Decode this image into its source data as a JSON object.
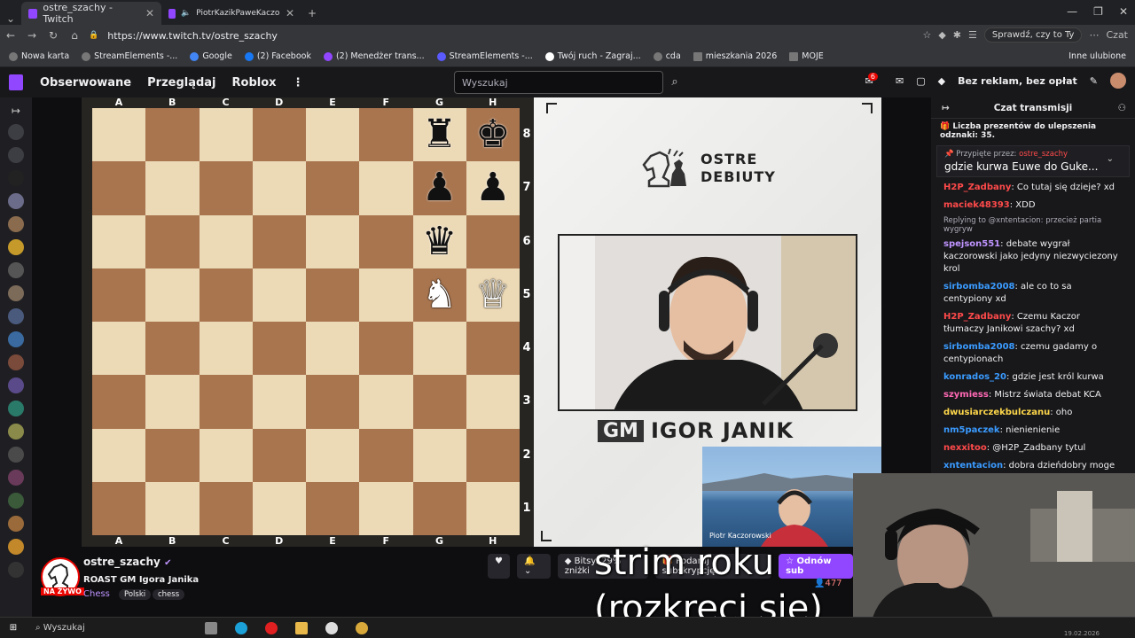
{
  "browser": {
    "tabs": [
      {
        "label": "ostre_szachy - Twitch",
        "active": true
      },
      {
        "label": "PiotrKazikPaweKaczorowski -",
        "active": false
      }
    ],
    "url": "https://www.twitch.tv/ostre_szachy",
    "ai_prompt": "Sprawdź, czy to Ty",
    "copilot": "Czat",
    "bookmarks": [
      "Nowa karta",
      "StreamElements -...",
      "Google",
      "(2) Facebook",
      "(2) Menedżer trans...",
      "StreamElements -...",
      "Twój ruch - Zagraj...",
      "cda",
      "mieszkania 2026",
      "MOJE"
    ],
    "bookmarks_other": "Inne ulubione"
  },
  "twitch_nav": {
    "following": "Obserwowane",
    "browse": "Przeglądaj",
    "roblox": "Roblox",
    "search_placeholder": "Wyszukaj",
    "notif_count": "6",
    "ad_free": "Bez reklam, bez opłat"
  },
  "chessboard": {
    "files": [
      "A",
      "B",
      "C",
      "D",
      "E",
      "F",
      "G",
      "H"
    ],
    "ranks": [
      "8",
      "7",
      "6",
      "5",
      "4",
      "3",
      "2",
      "1"
    ],
    "pieces": [
      {
        "square": "g8",
        "piece": "♜",
        "color": "black"
      },
      {
        "square": "h8",
        "piece": "♚",
        "color": "black"
      },
      {
        "square": "g7",
        "piece": "♟",
        "color": "black"
      },
      {
        "square": "h7",
        "piece": "♟",
        "color": "black"
      },
      {
        "square": "g6",
        "piece": "♛",
        "color": "black"
      },
      {
        "square": "g5",
        "piece": "♞",
        "color": "white"
      },
      {
        "square": "h5",
        "piece": "♕",
        "color": "white"
      }
    ]
  },
  "panel": {
    "brand_line1": "OSTRE",
    "brand_line2": "DEBIUTY",
    "gm": "GM",
    "player_name": "IGOR JANIK",
    "inset_label": "Piotr Kaczorowski"
  },
  "chat": {
    "header": "Czat transmisji",
    "gift_banner": "Liczba prezentów do ulepszenia odznaki: 35.",
    "pinned_by": "Przypięte przez:",
    "pinned_user": "ostre_szachy",
    "pinned_message": "gdzie kurwa Euwe do Guke...",
    "reply_to": "Replying to @xntentacion: przecież partia wygryw",
    "messages": [
      {
        "user": "H2P_Zadbany",
        "color": "#ff4a4a",
        "text": ": Co tutaj się dzieje? xd"
      },
      {
        "user": "maciek48393",
        "color": "#ff4a4a",
        "text": ": XDD"
      },
      {
        "user": "spejson551",
        "color": "#bf94ff",
        "text": ": debate wygrał kaczorowski jako jedyny niezwyciezony krol"
      },
      {
        "user": "sirbomba2008",
        "color": "#3a9bff",
        "text": ": ale co to sa centypiony xd"
      },
      {
        "user": "H2P_Zadbany",
        "color": "#ff4a4a",
        "text": ": Czemu Kaczor tłumaczy Janikowi szachy? xd"
      },
      {
        "user": "sirbomba2008",
        "color": "#3a9bff",
        "text": ": czemu gadamy o centypionach"
      },
      {
        "user": "konrados_20",
        "color": "#3a9bff",
        "text": ": gdzie jest król kurwa"
      },
      {
        "user": "szymiess",
        "color": "#ff69b4",
        "text": ": Mistrz świata debat KCA"
      },
      {
        "user": "dwusiarczekbulczanu",
        "color": "#ffd84a",
        "text": ": oho"
      },
      {
        "user": "nm5paczek",
        "color": "#3a9bff",
        "text": ": nienienienie"
      },
      {
        "user": "nexxitoo",
        "color": "#ff4a4a",
        "text": ": @H2P_Zadbany tytul"
      },
      {
        "user": "xntentacion",
        "color": "#3a9bff",
        "text": ": dobra dzieńdobry moge"
      }
    ]
  },
  "stream": {
    "channel": "ostre_szachy",
    "title": "ROAST GM Igora Janika",
    "category": "Chess",
    "tags": [
      "Polski",
      "chess"
    ],
    "live_label": "NA ŻYWO",
    "bits_label": "Bitsy: 29% zniżki",
    "gift_label": "Podaruj subskrypcję",
    "subscribe_label": "Odnów sub",
    "viewers": "477"
  },
  "subtitle": {
    "line1": "strim roku",
    "line2": "(rozkreci sie)"
  },
  "taskbar": {
    "search": "Wyszukaj",
    "date": "19.02.2026"
  }
}
